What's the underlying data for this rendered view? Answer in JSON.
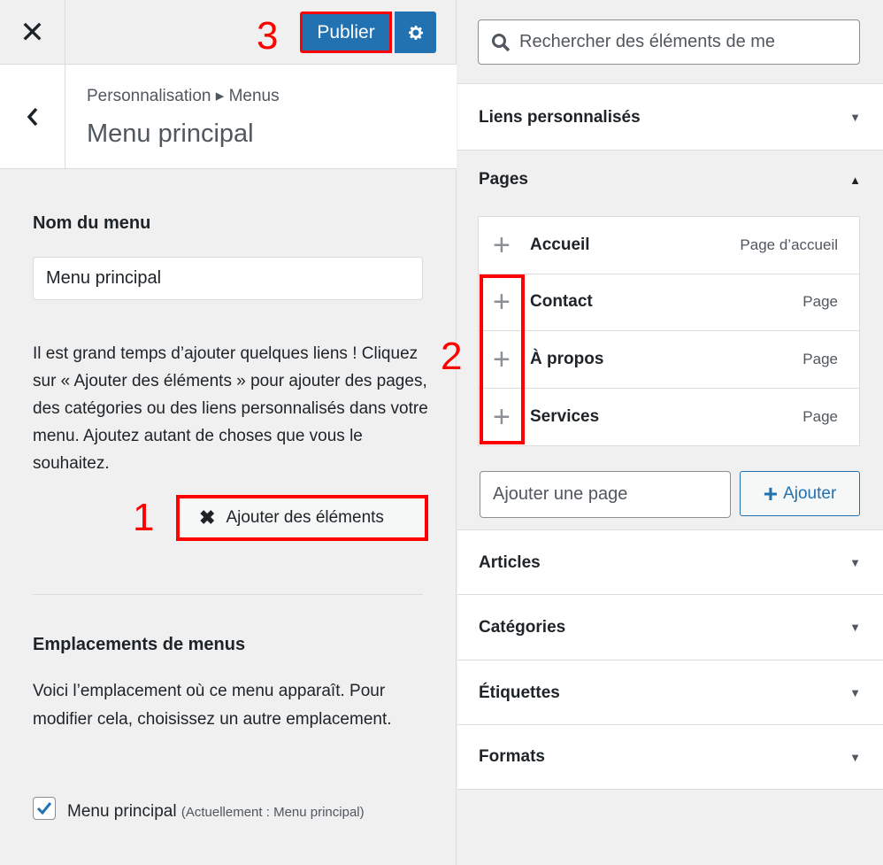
{
  "topbar": {
    "close_label": "✕",
    "publish_label": "Publier",
    "annotation_3": "3"
  },
  "header": {
    "breadcrumb": "Personnalisation ▸ Menus",
    "title": "Menu principal"
  },
  "menu_name": {
    "heading": "Nom du menu",
    "value": "Menu principal"
  },
  "help_text": "Il est grand temps d’ajouter quelques liens ! Cliquez sur « Ajouter des éléments » pour ajouter des pages, des catégories ou des liens personnalisés dans votre menu. Ajoutez autant de choses que vous le souhaitez.",
  "add_items": {
    "icon": "✖",
    "label": "Ajouter des éléments",
    "annotation_1": "1"
  },
  "locations": {
    "heading": "Emplacements de menus",
    "description": "Voici l’emplacement où ce menu apparaît. Pour modifier cela, choisissez un autre emplacement.",
    "checkbox_label": "Menu principal",
    "checkbox_note": "(Actuellement : Menu principal)",
    "checked": true
  },
  "search": {
    "placeholder": "Rechercher des éléments de me"
  },
  "accordion": {
    "custom_links": "Liens personnalisés",
    "pages": "Pages",
    "articles": "Articles",
    "categories": "Catégories",
    "tags": "Étiquettes",
    "formats": "Formats",
    "arrow_down": "▼",
    "arrow_up": "▲"
  },
  "pages_list": [
    {
      "title": "Accueil",
      "type": "Page d’accueil",
      "plus": "+"
    },
    {
      "title": "Contact",
      "type": "Page",
      "plus": "+"
    },
    {
      "title": "À propos",
      "type": "Page",
      "plus": "+"
    },
    {
      "title": "Services",
      "type": "Page",
      "plus": "+"
    }
  ],
  "add_page": {
    "placeholder": "Ajouter une page",
    "button_icon": "+",
    "button_label": "Ajouter",
    "annotation_2": "2"
  },
  "colors": {
    "primary": "#2271b1",
    "annotation": "#ff0000"
  }
}
